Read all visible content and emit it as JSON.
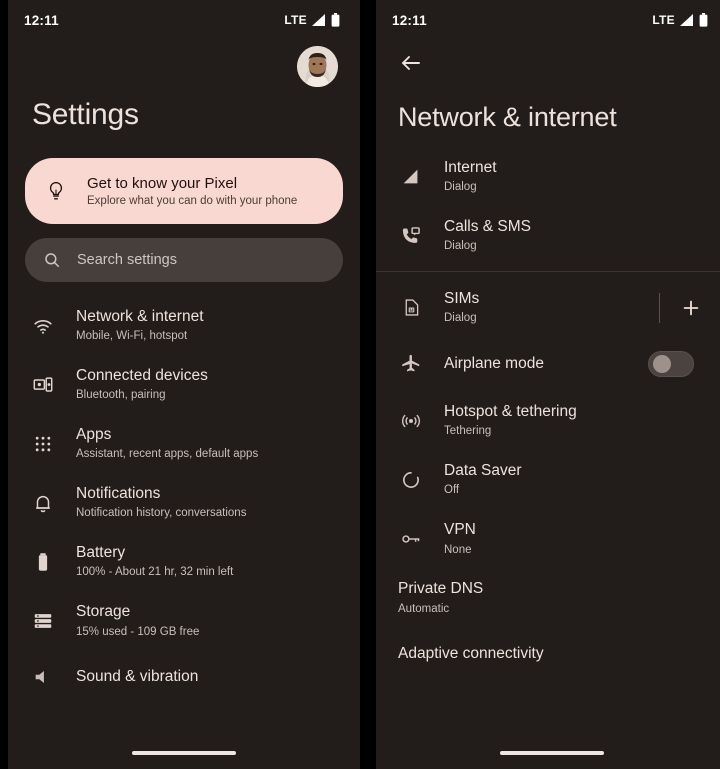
{
  "colors": {
    "background": "#221D1A",
    "promo_card": "#F9D8D1",
    "search_bar": "#473F3C",
    "text_primary": "#EEE2DD",
    "text_secondary": "#CBBFBA",
    "toggle_track": "#4B4340",
    "toggle_knob": "#9E918C",
    "divider": "#3C3431",
    "gap": "#000000"
  },
  "left": {
    "status": {
      "time": "12:11",
      "network": "LTE",
      "signal_icon": "signal-bars-icon",
      "battery_icon": "battery-full-icon"
    },
    "avatar": {
      "name": "account-avatar"
    },
    "title": "Settings",
    "promo": {
      "icon": "lightbulb-icon",
      "title": "Get to know your Pixel",
      "subtitle": "Explore what you can do with your phone"
    },
    "search": {
      "icon": "search-icon",
      "placeholder": "Search settings",
      "value": ""
    },
    "items": [
      {
        "icon": "wifi-icon",
        "title": "Network & internet",
        "subtitle": "Mobile, Wi-Fi, hotspot"
      },
      {
        "icon": "connected-devices-icon",
        "title": "Connected devices",
        "subtitle": "Bluetooth, pairing"
      },
      {
        "icon": "apps-grid-icon",
        "title": "Apps",
        "subtitle": "Assistant, recent apps, default apps"
      },
      {
        "icon": "bell-icon",
        "title": "Notifications",
        "subtitle": "Notification history, conversations"
      },
      {
        "icon": "battery-icon",
        "title": "Battery",
        "subtitle": "100% - About 21 hr, 32 min left"
      },
      {
        "icon": "storage-icon",
        "title": "Storage",
        "subtitle": "15% used - 109 GB free"
      },
      {
        "icon": "sound-icon",
        "title": "Sound & vibration",
        "subtitle": ""
      }
    ]
  },
  "right": {
    "status": {
      "time": "12:11",
      "network": "LTE",
      "signal_icon": "signal-bars-icon",
      "battery_icon": "battery-full-icon"
    },
    "back_icon": "back-arrow-icon",
    "title": "Network & internet",
    "items": [
      {
        "icon": "signal-triangle-icon",
        "title": "Internet",
        "subtitle": "Dialog",
        "trailing": "none"
      },
      {
        "icon": "calls-sms-icon",
        "title": "Calls & SMS",
        "subtitle": "Dialog",
        "trailing": "none"
      },
      {
        "icon": "sim-card-icon",
        "title": "SIMs",
        "subtitle": "Dialog",
        "trailing": "add"
      },
      {
        "icon": "airplane-icon",
        "title": "Airplane mode",
        "subtitle": "",
        "trailing": "toggle",
        "toggle_on": false
      },
      {
        "icon": "hotspot-icon",
        "title": "Hotspot & tethering",
        "subtitle": "Tethering",
        "trailing": "none"
      },
      {
        "icon": "data-saver-icon",
        "title": "Data Saver",
        "subtitle": "Off",
        "trailing": "none"
      },
      {
        "icon": "vpn-key-icon",
        "title": "VPN",
        "subtitle": "None",
        "trailing": "none"
      },
      {
        "icon": "none",
        "title": "Private DNS",
        "subtitle": "Automatic",
        "trailing": "none"
      },
      {
        "icon": "none",
        "title": "Adaptive connectivity",
        "subtitle": "",
        "trailing": "none"
      }
    ],
    "add_label": "+"
  }
}
